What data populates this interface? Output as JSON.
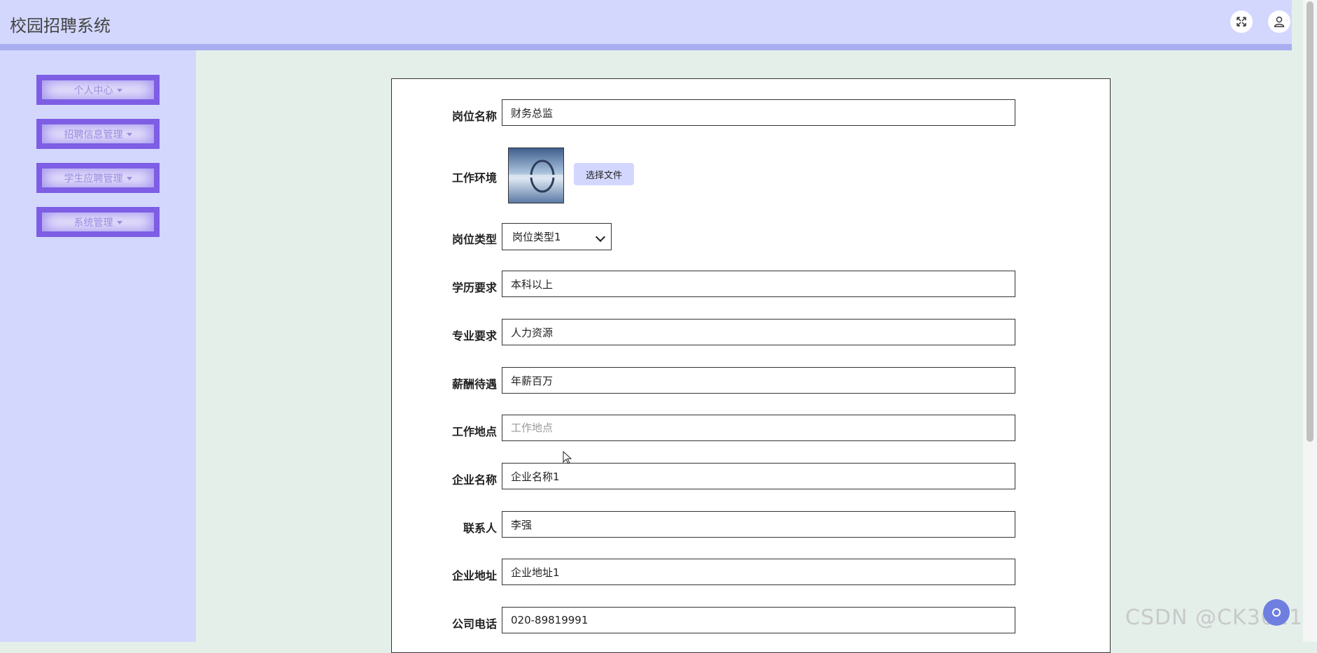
{
  "app": {
    "title": "校园招聘系统"
  },
  "header": {
    "fullscreen_icon": "expand-icon",
    "user_icon": "user-icon"
  },
  "sidebar": {
    "items": [
      {
        "label": "个人中心"
      },
      {
        "label": "招聘信息管理"
      },
      {
        "label": "学生应聘管理"
      },
      {
        "label": "系统管理"
      }
    ]
  },
  "form": {
    "job_name": {
      "label": "岗位名称",
      "value": "财务总监"
    },
    "work_env": {
      "label": "工作环境",
      "file_button": "选择文件"
    },
    "job_type": {
      "label": "岗位类型",
      "selected": "岗位类型1"
    },
    "education": {
      "label": "学历要求",
      "value": "本科以上"
    },
    "major": {
      "label": "专业要求",
      "value": "人力资源"
    },
    "salary": {
      "label": "薪酬待遇",
      "value": "年薪百万"
    },
    "location": {
      "label": "工作地点",
      "value": "",
      "placeholder": "工作地点"
    },
    "company": {
      "label": "企业名称",
      "value": "企业名称1"
    },
    "contact": {
      "label": "联系人",
      "value": "李强"
    },
    "address": {
      "label": "企业地址",
      "value": "企业地址1"
    },
    "phone": {
      "label": "公司电话",
      "value": "020-89819991"
    }
  },
  "watermark": "CSDN @CK3011",
  "colors": {
    "header": "#d3d7fe",
    "accent": "#7d5ee4",
    "content_bg": "#e4efea"
  }
}
